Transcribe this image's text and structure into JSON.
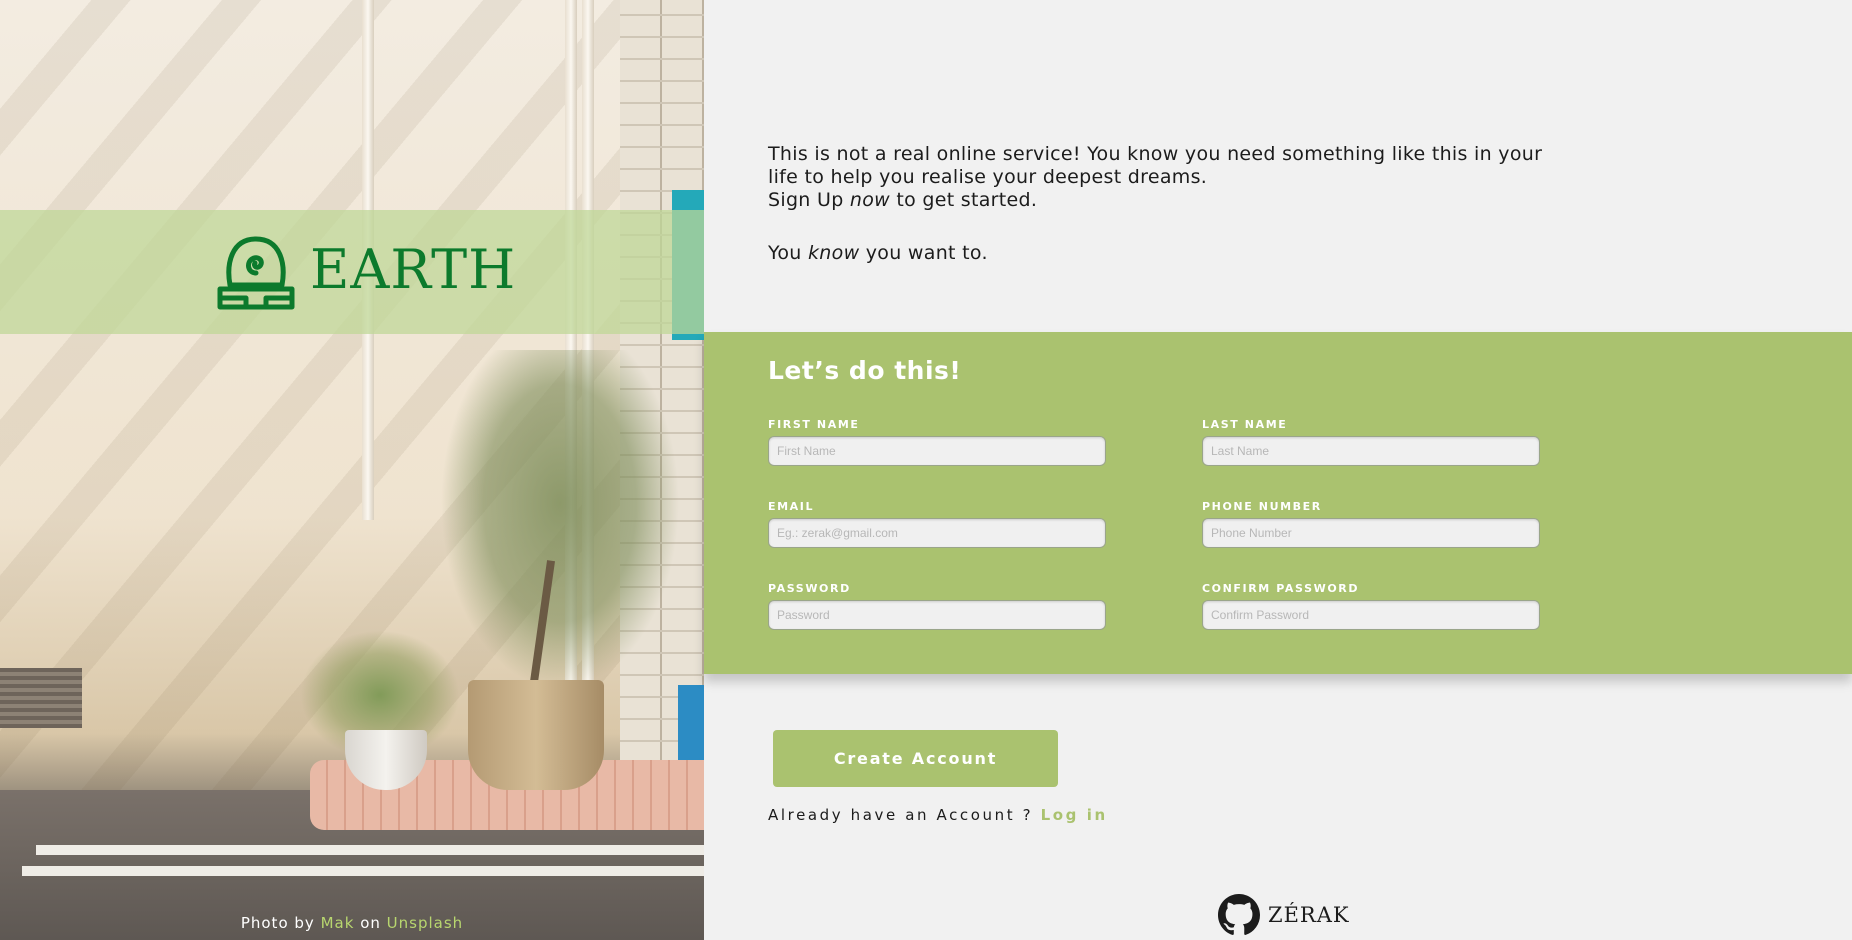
{
  "brand": {
    "name": "EARTH",
    "logo_icon": "earth-kingdom-emblem-icon",
    "color": "#0c7a2c"
  },
  "photo_credit": {
    "prefix": "Photo by",
    "author": "Mak",
    "middle": "on",
    "source": "Unsplash"
  },
  "intro": {
    "line1": "This is not a real online service! You know you need something like this in your",
    "line2": "life to help you realise your deepest dreams.",
    "line3_pre": "Sign Up ",
    "line3_em": "now",
    "line3_post": " to get started.",
    "line4_pre": "You ",
    "line4_em": "know",
    "line4_post": " you want to."
  },
  "form": {
    "title": "Let’s do this!",
    "accent_color": "#aac26f",
    "fields": {
      "first_name": {
        "label": "FIRST NAME",
        "placeholder": "First Name",
        "value": ""
      },
      "last_name": {
        "label": "LAST NAME",
        "placeholder": "Last Name",
        "value": ""
      },
      "email": {
        "label": "EMAIL",
        "placeholder": "Eg.: zerak@gmail.com",
        "value": ""
      },
      "phone": {
        "label": "PHONE NUMBER",
        "placeholder": "Phone Number",
        "value": ""
      },
      "password": {
        "label": "PASSWORD",
        "placeholder": "Password",
        "value": ""
      },
      "confirm_password": {
        "label": "CONFIRM PASSWORD",
        "placeholder": "Confirm Password",
        "value": ""
      }
    }
  },
  "actions": {
    "create_account": "Create Account",
    "login_prompt": "Already have an Account ? ",
    "login_link": "Log in"
  },
  "footer": {
    "icon": "github-icon",
    "author": "ZÉRAK"
  }
}
